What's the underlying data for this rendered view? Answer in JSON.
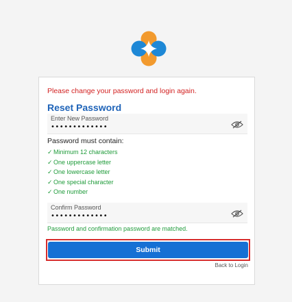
{
  "logo": {
    "icon": "brand-logo-icon",
    "colors": {
      "blue": "#1e88d6",
      "orange": "#f29a2e"
    }
  },
  "alert": {
    "text": "Please change your password and login again."
  },
  "form": {
    "title": "Reset Password",
    "new_password": {
      "label": "Enter New Password",
      "value": "•••••••••••••",
      "toggle_icon": "eye-slash-icon"
    },
    "rules_title": "Password must contain:",
    "rules": [
      "Minimum 12 characters",
      "One uppercase letter",
      "One lowercase letter",
      "One special character",
      "One number"
    ],
    "check_symbol": "✓",
    "confirm_password": {
      "label": "Confirm Password",
      "value": "•••••••••••••",
      "toggle_icon": "eye-slash-icon"
    },
    "match_message": "Password and confirmation password are matched.",
    "submit_label": "Submit",
    "back_label": "Back to Login"
  },
  "colors": {
    "accent": "#1670d4",
    "title": "#1e63b8",
    "error": "#d21f1f",
    "success": "#1f9b3a",
    "highlight": "#d72c2c"
  }
}
